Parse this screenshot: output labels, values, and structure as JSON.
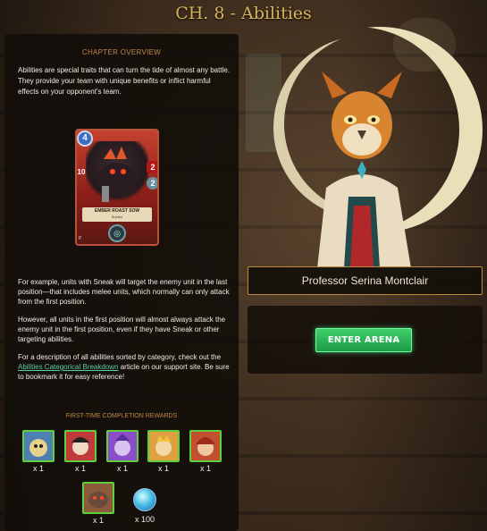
{
  "title": {
    "chapter": "CH. 8 - ",
    "name": "Abilities"
  },
  "overview": {
    "heading": "CHAPTER OVERVIEW",
    "intro": "Abilities are special traits that can turn the tide of almost any battle. They provide your team with unique benefits or inflict harmful effects on your opponent's team."
  },
  "card": {
    "mana": "4",
    "attack": "2",
    "speed": "2",
    "level": "10",
    "name": "EMBER ROAST SOW",
    "subtitle": "Sulden",
    "corner": "P"
  },
  "body": {
    "p1": "For example, units with Sneak will target the enemy unit in the last position—that includes melee units, which normally can only attack from the first position.",
    "p2": "However, all units in the first position will almost always attack the enemy unit in the first position, even if they have Sneak or other targeting abilities.",
    "p3_before": "For a description of all abilities sorted by category, check out the ",
    "p3_link": "Abilities Categorical Breakdown",
    "p3_after": " article on our support site. Be sure to bookmark it for easy reference!"
  },
  "rewards": {
    "heading": "FIRST-TIME COMPLETION REWARDS",
    "items": [
      {
        "qty": "x 1",
        "color": "#4d7fb0"
      },
      {
        "qty": "x 1",
        "color": "#c03a3a"
      },
      {
        "qty": "x 1",
        "color": "#8a4fc8"
      },
      {
        "qty": "x 1",
        "color": "#e0a040"
      },
      {
        "qty": "x 1",
        "color": "#c05030"
      },
      {
        "qty": "x 1",
        "color": "#8a5a3a"
      }
    ],
    "potion_qty": "x 100"
  },
  "professor": {
    "name": "Professor Serina Montclair"
  },
  "action": {
    "enter_label": "ENTER ARENA"
  }
}
